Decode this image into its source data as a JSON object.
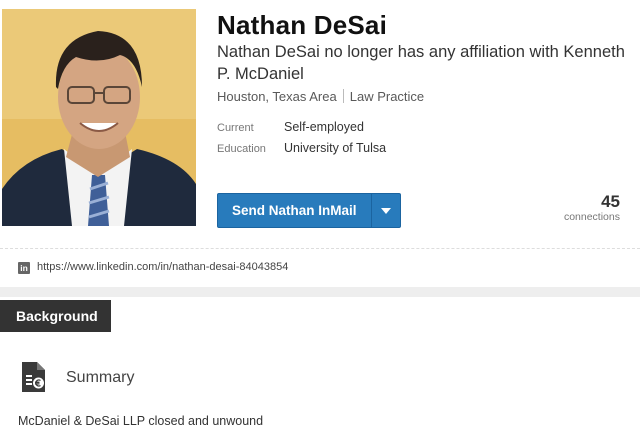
{
  "profile": {
    "name": "Nathan DeSai",
    "headline": "Nathan DeSai no longer has any affiliation with Kenneth P. McDaniel",
    "location": "Houston, Texas Area",
    "industry": "Law Practice",
    "current_label": "Current",
    "current_value": "Self-employed",
    "education_label": "Education",
    "education_value": "University of Tulsa",
    "inmail_button": "Send Nathan InMail",
    "connections_count": "45",
    "connections_label": "connections",
    "photo_icon": "profile-photo"
  },
  "url_bar": {
    "icon": "linkedin-icon",
    "icon_text": "in",
    "url": "https://www.linkedin.com/in/nathan-desai-84043854"
  },
  "background": {
    "tab_label": "Background",
    "summary_icon": "summary-document-icon",
    "summary_title": "Summary",
    "summary_text": "McDaniel & DeSai LLP closed and unwound"
  },
  "colors": {
    "accent": "#287bbc",
    "section_tab": "#333333",
    "photo_bg": "#e9c26a"
  }
}
